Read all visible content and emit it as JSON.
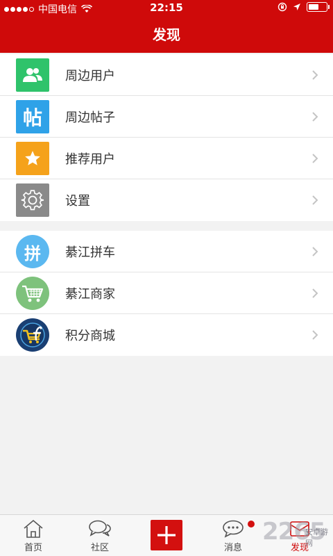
{
  "status": {
    "carrier": "中国电信",
    "time": "22:15"
  },
  "header": {
    "title": "发现"
  },
  "menu_group_1": [
    {
      "label": "周边用户",
      "icon": "users-icon",
      "color": "#2fc36b"
    },
    {
      "label": "周边帖子",
      "icon": "tie-char-icon",
      "icon_text": "帖",
      "color": "#2fa2e8"
    },
    {
      "label": "推荐用户",
      "icon": "star-icon",
      "color": "#f5a21b"
    },
    {
      "label": "设置",
      "icon": "gear-icon",
      "color": "#8a8a8a"
    }
  ],
  "menu_group_2": [
    {
      "label": "綦江拼车",
      "icon": "pin-char-icon",
      "icon_text": "拼",
      "color": "#5bb8f0"
    },
    {
      "label": "綦江商家",
      "icon": "shopping-cart-icon",
      "color": "#7ec27c"
    },
    {
      "label": "积分商城",
      "icon": "points-mall-icon",
      "color": "#1a3f73"
    }
  ],
  "tabbar": {
    "home": "首页",
    "community": "社区",
    "messages": "消息",
    "discover": "发现"
  },
  "watermark": {
    "big": "2265",
    "small": "安卓游网"
  },
  "colors": {
    "accent": "#cf0a0a"
  }
}
